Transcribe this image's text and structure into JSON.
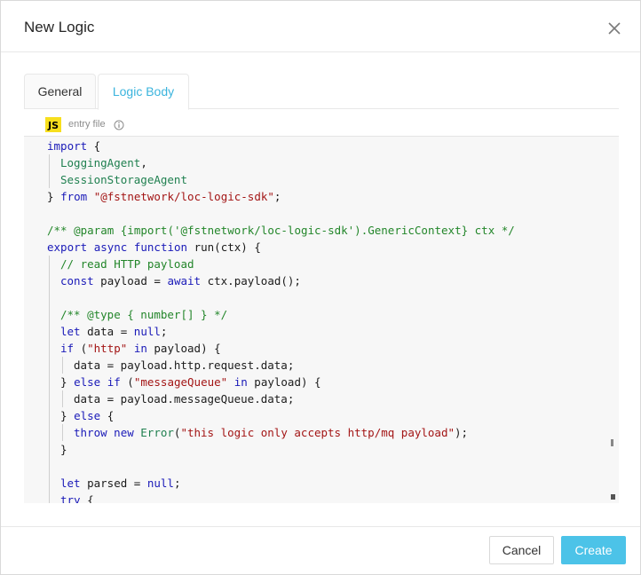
{
  "dialog": {
    "title": "New Logic",
    "close_icon": "close-icon"
  },
  "tabs": [
    {
      "label": "General",
      "active": false
    },
    {
      "label": "Logic Body",
      "active": true
    }
  ],
  "file": {
    "badge": "JS",
    "entry_label": "entry file",
    "info_icon": "info-icon"
  },
  "code": {
    "lines": [
      [
        [
          "kw",
          "import"
        ],
        [
          "fn",
          " {"
        ]
      ],
      [
        [
          "id",
          "LoggingAgent"
        ],
        [
          "fn",
          ","
        ]
      ],
      [
        [
          "id",
          "SessionStorageAgent"
        ]
      ],
      [
        [
          "fn",
          "} "
        ],
        [
          "kw",
          "from"
        ],
        [
          "fn",
          " "
        ],
        [
          "str",
          "\"@fstnetwork/loc-logic-sdk\""
        ],
        [
          "fn",
          ";"
        ]
      ],
      [],
      [
        [
          "com",
          "/** @param {import('@fstnetwork/loc-logic-sdk').GenericContext} ctx */"
        ]
      ],
      [
        [
          "kw",
          "export"
        ],
        [
          "fn",
          " "
        ],
        [
          "kw",
          "async"
        ],
        [
          "fn",
          " "
        ],
        [
          "kw",
          "function"
        ],
        [
          "fn",
          " run(ctx) {"
        ]
      ],
      [
        [
          "com",
          "// read HTTP payload"
        ]
      ],
      [
        [
          "kw",
          "const"
        ],
        [
          "fn",
          " payload = "
        ],
        [
          "kw",
          "await"
        ],
        [
          "fn",
          " ctx.payload();"
        ]
      ],
      [],
      [
        [
          "com",
          "/** @type { number[] } */"
        ]
      ],
      [
        [
          "kw",
          "let"
        ],
        [
          "fn",
          " data = "
        ],
        [
          "kw",
          "null"
        ],
        [
          "fn",
          ";"
        ]
      ],
      [
        [
          "kw",
          "if"
        ],
        [
          "fn",
          " ("
        ],
        [
          "str",
          "\"http\""
        ],
        [
          "fn",
          " "
        ],
        [
          "kw",
          "in"
        ],
        [
          "fn",
          " payload) {"
        ]
      ],
      [
        [
          "fn",
          "data = payload.http.request.data;"
        ]
      ],
      [
        [
          "fn",
          "} "
        ],
        [
          "kw",
          "else"
        ],
        [
          "fn",
          " "
        ],
        [
          "kw",
          "if"
        ],
        [
          "fn",
          " ("
        ],
        [
          "str",
          "\"messageQueue\""
        ],
        [
          "fn",
          " "
        ],
        [
          "kw",
          "in"
        ],
        [
          "fn",
          " payload) {"
        ]
      ],
      [
        [
          "fn",
          "data = payload.messageQueue.data;"
        ]
      ],
      [
        [
          "fn",
          "} "
        ],
        [
          "kw",
          "else"
        ],
        [
          "fn",
          " {"
        ]
      ],
      [
        [
          "kw",
          "throw"
        ],
        [
          "fn",
          " "
        ],
        [
          "kw",
          "new"
        ],
        [
          "fn",
          " "
        ],
        [
          "id",
          "Error"
        ],
        [
          "fn",
          "("
        ],
        [
          "str",
          "\"this logic only accepts http/mq payload\""
        ],
        [
          "fn",
          ");"
        ]
      ],
      [
        [
          "fn",
          "}"
        ]
      ],
      [],
      [
        [
          "kw",
          "let"
        ],
        [
          "fn",
          " parsed = "
        ],
        [
          "kw",
          "null"
        ],
        [
          "fn",
          ";"
        ]
      ],
      [
        [
          "kw",
          "try"
        ],
        [
          "fn",
          " {"
        ]
      ]
    ],
    "indents": [
      0,
      1,
      1,
      0,
      0,
      0,
      0,
      1,
      1,
      1,
      1,
      1,
      1,
      2,
      1,
      2,
      1,
      2,
      1,
      1,
      1,
      1
    ]
  },
  "footer": {
    "cancel_label": "Cancel",
    "create_label": "Create"
  },
  "colors": {
    "accent": "#3bb4dd",
    "primary_button": "#4cc3e8",
    "keyword": "#1a1ab8",
    "string": "#a31515",
    "comment": "#23862a"
  }
}
